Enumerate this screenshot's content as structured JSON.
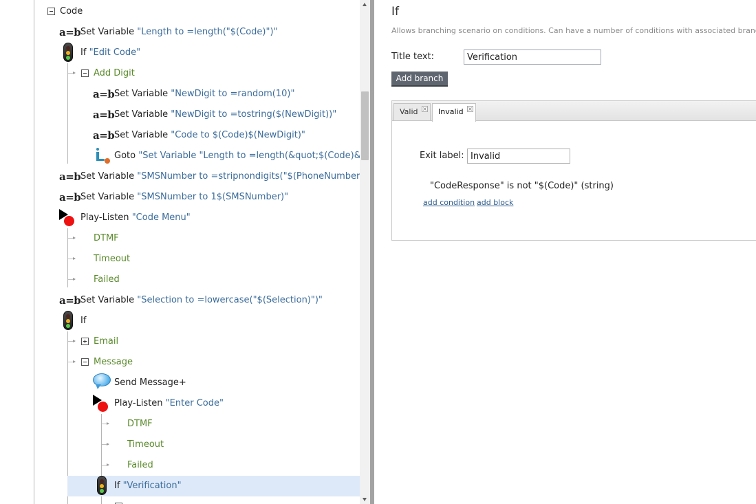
{
  "tree": {
    "rows": [
      {
        "label": "Code",
        "icon": "expander-minus",
        "style": "plain"
      },
      {
        "key": "Set Variable",
        "value": "\"Length to =length(\"$(Code)\")\"",
        "icon": "a-eq-b"
      },
      {
        "key": "If",
        "value": "\"Edit Code\"",
        "icon": "traffic-light"
      },
      {
        "label": "Add Digit",
        "icon": "expander-minus",
        "style": "green"
      },
      {
        "key": "Set Variable",
        "value": "\"NewDigit to =random(10)\"",
        "icon": "a-eq-b"
      },
      {
        "key": "Set Variable",
        "value": "\"NewDigit to =tostring($(NewDigit))\"",
        "icon": "a-eq-b"
      },
      {
        "key": "Set Variable",
        "value": "\"Code to $(Code)$(NewDigit)\"",
        "icon": "a-eq-b"
      },
      {
        "key": "Goto",
        "value": "\"Set Variable \"Length to =length(&quot;$(Code)&quot;)\"\"",
        "icon": "goto"
      },
      {
        "key": "Set Variable",
        "value": "\"SMSNumber to =stripnondigits(\"$(PhoneNumber)\")\"",
        "icon": "a-eq-b"
      },
      {
        "key": "Set Variable",
        "value": "\"SMSNumber to 1$(SMSNumber)\"",
        "icon": "a-eq-b"
      },
      {
        "key": "Play-Listen",
        "value": "\"Code Menu\"",
        "icon": "play-listen"
      },
      {
        "label": "DTMF",
        "style": "green"
      },
      {
        "label": "Timeout",
        "style": "green"
      },
      {
        "label": "Failed",
        "style": "green"
      },
      {
        "key": "Set Variable",
        "value": "\"Selection to =lowercase(\"$(Selection)\")\"",
        "icon": "a-eq-b"
      },
      {
        "key": "If",
        "value": "",
        "icon": "traffic-light"
      },
      {
        "label": "Email",
        "icon": "expander-plus",
        "style": "green"
      },
      {
        "label": "Message",
        "icon": "expander-minus",
        "style": "green"
      },
      {
        "key": "Send Message+",
        "value": "",
        "icon": "speech-bubble"
      },
      {
        "key": "Play-Listen",
        "value": "\"Enter Code\"",
        "icon": "play-listen"
      },
      {
        "label": "DTMF",
        "style": "green"
      },
      {
        "label": "Timeout",
        "style": "green"
      },
      {
        "label": "Failed",
        "style": "green"
      },
      {
        "key": "If",
        "value": "\"Verification\"",
        "icon": "traffic-light",
        "selected": true
      }
    ]
  },
  "panel": {
    "title": "If",
    "description": "Allows branching scenario on conditions. Can have a number of conditions with associated branches.",
    "title_text_label": "Title text:",
    "title_text_value": "Verification",
    "add_branch_label": "Add branch",
    "tabs": [
      {
        "label": "Valid",
        "active": false
      },
      {
        "label": "Invalid",
        "active": true
      }
    ],
    "exit_label_label": "Exit label:",
    "exit_label_value": "Invalid",
    "condition": "\"CodeResponse\" is not \"$(Code)\" (string)",
    "add_condition_label": "add condition",
    "add_block_label": "add block"
  }
}
